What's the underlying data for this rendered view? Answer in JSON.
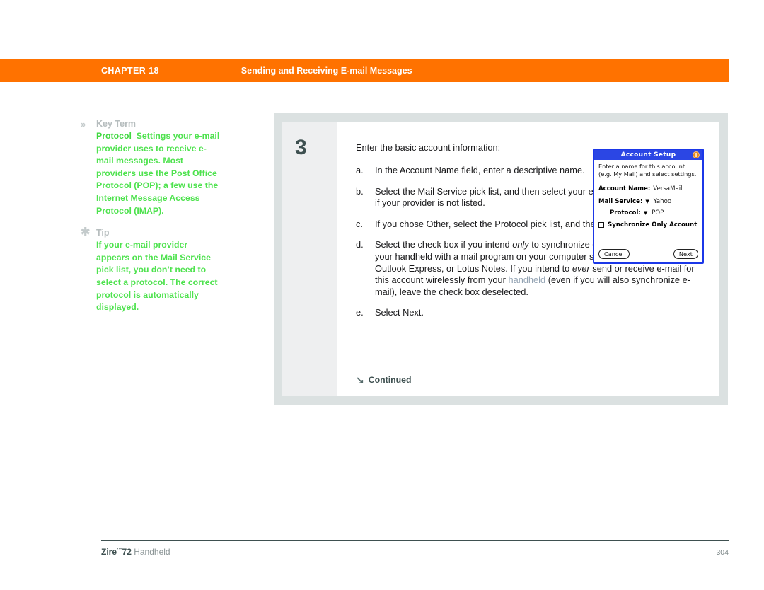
{
  "header": {
    "chapter_label": "CHAPTER 18",
    "section_title": "Sending and Receiving E-mail Messages",
    "bar_color": "#ff7200"
  },
  "sidebar": {
    "notes": [
      {
        "icon": "double-chevron-right-icon",
        "icon_glyph": "»",
        "title": "Key Term",
        "term": "Protocol",
        "body": "Settings your e-mail provider uses to receive e-mail messages. Most providers use the Post Office Protocol (POP); a few use the Internet Message Access Protocol (IMAP)."
      },
      {
        "icon": "asterisk-icon",
        "icon_glyph": "✱",
        "title": "Tip",
        "term": "",
        "body": "If your e-mail provider appears on the Mail Service pick list, you don’t need to select a protocol. The correct protocol is automatically displayed."
      }
    ],
    "text_color": "#4ee24e",
    "title_color": "#b6bdbe"
  },
  "main": {
    "step_number": "3",
    "lead": "Enter the basic account information:",
    "substeps": [
      {
        "marker": "a.",
        "text": "In the Account Name field, enter a descriptive name."
      },
      {
        "marker": "b.",
        "text": "Select the Mail Service pick list, and then select your e-mail provider. Select Other if your provider is not listed."
      },
      {
        "marker": "c.",
        "text": "If you chose Other, select the Protocol pick list, and then select POP or IMAP."
      },
      {
        "marker": "d.",
        "text_parts": [
          {
            "t": "Select the check box if you intend ",
            "style": "normal"
          },
          {
            "t": "only",
            "style": "italic"
          },
          {
            "t": " to synchronize e-mail for this account on your handheld with a mail program on your computer such as Microsoft Outlook, Outlook Express, or Lotus Notes. If you intend to ",
            "style": "normal"
          },
          {
            "t": "ever",
            "style": "italic"
          },
          {
            "t": " send or receive e-mail for this account wirelessly from your ",
            "style": "normal"
          },
          {
            "t": "handheld",
            "style": "link"
          },
          {
            "t": " (even if you will also synchronize e-mail), leave the check box deselected.",
            "style": "normal"
          }
        ]
      },
      {
        "marker": "e.",
        "text": "Select Next."
      }
    ],
    "continued_icon": "arrow-down-right-icon",
    "continued_glyph": "↘",
    "continued_label": "Continued"
  },
  "pda": {
    "title": "Account Setup",
    "info_icon": "info-icon",
    "info_glyph": "i",
    "description": "Enter a name for this account (e.g. My Mail) and select settings.",
    "fields": [
      {
        "label": "Account Name:",
        "value": "VersaMail",
        "type": "text"
      },
      {
        "label": "Mail Service:",
        "value": "Yahoo",
        "type": "picklist"
      },
      {
        "label": "Protocol:",
        "value": "POP",
        "type": "picklist"
      }
    ],
    "checkbox": {
      "label": "Synchronize Only Account",
      "checked": false
    },
    "buttons": {
      "cancel": "Cancel",
      "next": "Next"
    },
    "title_bar_color": "#2b46e4"
  },
  "footer": {
    "brand": "Zire",
    "tm": "™",
    "model": "72",
    "product": "Handheld",
    "page_number": "304"
  }
}
